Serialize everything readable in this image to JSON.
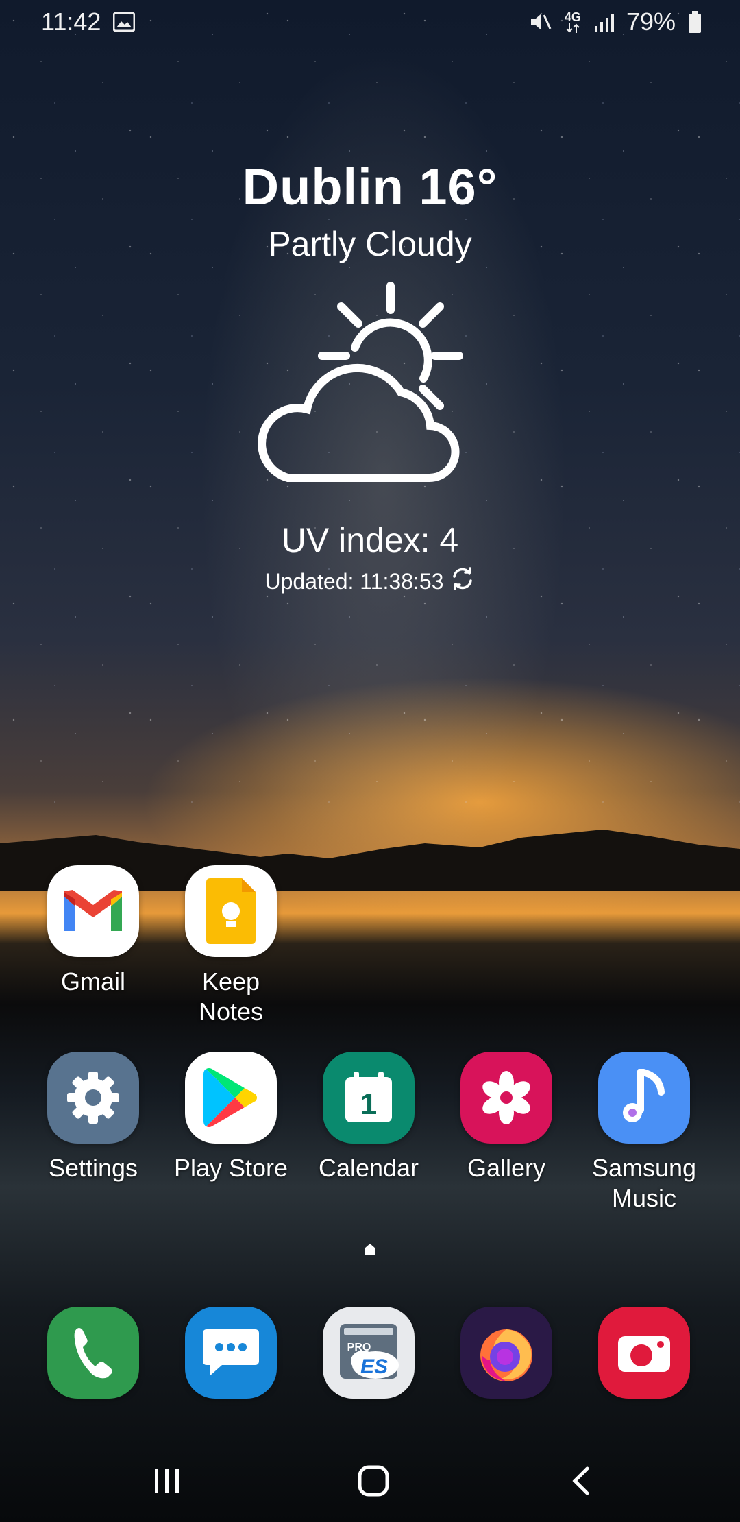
{
  "status_bar": {
    "time": "11:42",
    "battery": "79%",
    "network": "4G",
    "icons": [
      "image-icon",
      "mute-icon",
      "network-4g-icon",
      "signal-icon",
      "battery-icon"
    ]
  },
  "weather": {
    "title": "Dublin 16°",
    "condition": "Partly Cloudy",
    "uv": "UV index: 4",
    "updated": "Updated: 11:38:53",
    "icon": "partly-cloudy-icon"
  },
  "apps_row1": [
    {
      "label": "Gmail",
      "icon": "gmail-icon"
    },
    {
      "label": "Keep\nNotes",
      "icon": "keep-notes-icon"
    }
  ],
  "apps_row2": [
    {
      "label": "Settings",
      "icon": "gear-icon"
    },
    {
      "label": "Play Store",
      "icon": "play-store-icon"
    },
    {
      "label": "Calendar",
      "icon": "calendar-icon",
      "day": "1"
    },
    {
      "label": "Gallery",
      "icon": "gallery-icon"
    },
    {
      "label": "Samsung\nMusic",
      "icon": "music-icon"
    }
  ],
  "dock": [
    {
      "icon": "phone-icon"
    },
    {
      "icon": "messages-icon"
    },
    {
      "icon": "es-file-explorer-icon",
      "badge": "PRO"
    },
    {
      "icon": "firefox-icon"
    },
    {
      "icon": "camera-icon"
    }
  ],
  "nav": [
    "recents-icon",
    "home-icon",
    "back-icon"
  ],
  "colors": {
    "calendar": "#0a8a6e",
    "gallery": "#d8135a",
    "music": "#4a90f5",
    "phone": "#2f9a4e",
    "messages": "#1787d8",
    "camera": "#e01a3c",
    "settings": "#58738f"
  }
}
